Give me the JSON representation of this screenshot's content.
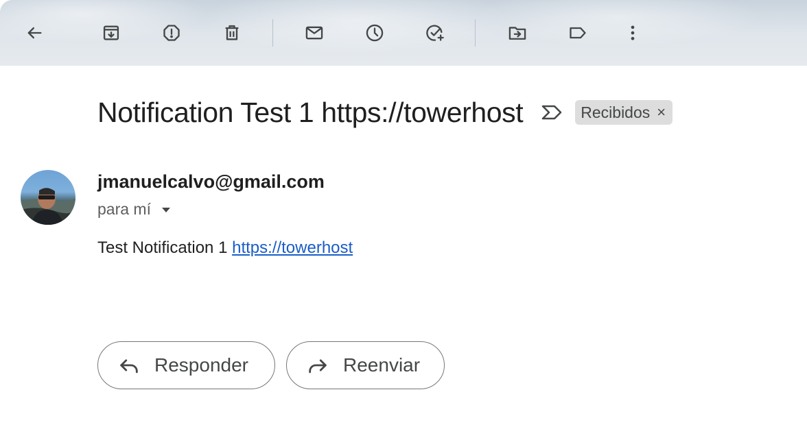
{
  "toolbar": {
    "icons": [
      "back-arrow-icon",
      "archive-icon",
      "report-spam-icon",
      "delete-icon",
      "mark-unread-icon",
      "snooze-icon",
      "add-task-icon",
      "move-to-icon",
      "label-icon",
      "more-vert-icon"
    ]
  },
  "message": {
    "subject": "Notification Test 1 https://towerhost",
    "label_chip": "Recibidos",
    "label_chip_close": "×",
    "sender": "jmanuelcalvo@gmail.com",
    "to_line": "para mí",
    "body_text": "Test Notification 1 ",
    "body_link": "https://towerhost"
  },
  "actions": {
    "reply_label": "Responder",
    "forward_label": "Reenviar"
  },
  "colors": {
    "link": "#1a5dc6",
    "chip_bg": "#dddddd",
    "text": "#1f1f1f"
  }
}
